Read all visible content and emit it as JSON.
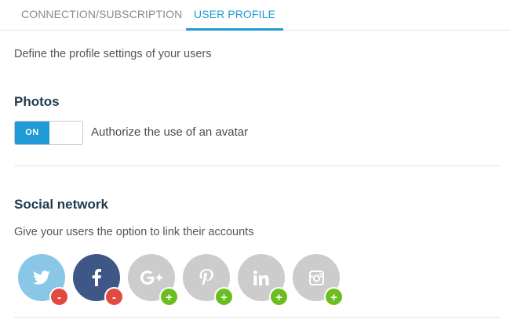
{
  "tabs": [
    {
      "label": "CONNECTION/SUBSCRIPTION",
      "active": false
    },
    {
      "label": "USER PROFILE",
      "active": true
    }
  ],
  "intro": "Define the profile settings of your users",
  "photos": {
    "title": "Photos",
    "toggle_state": "ON",
    "toggle_label": "Authorize the use of an avatar"
  },
  "social": {
    "title": "Social network",
    "description": "Give your users the option to link their accounts",
    "networks": [
      {
        "icon": "twitter-icon",
        "color": "#8ac7e6",
        "linked": true,
        "badge": "-"
      },
      {
        "icon": "facebook-icon",
        "color": "#3f5786",
        "linked": true,
        "badge": "-"
      },
      {
        "icon": "google-plus-icon",
        "color": "#cccccc",
        "linked": false,
        "badge": "+"
      },
      {
        "icon": "pinterest-icon",
        "color": "#cccccc",
        "linked": false,
        "badge": "+"
      },
      {
        "icon": "linkedin-icon",
        "color": "#cccccc",
        "linked": false,
        "badge": "+"
      },
      {
        "icon": "instagram-icon",
        "color": "#cccccc",
        "linked": false,
        "badge": "+"
      }
    ]
  },
  "colors": {
    "accent": "#1f9ad6",
    "heading": "#1e3a4f",
    "remove": "#e04a3f",
    "add": "#6abf1e"
  }
}
